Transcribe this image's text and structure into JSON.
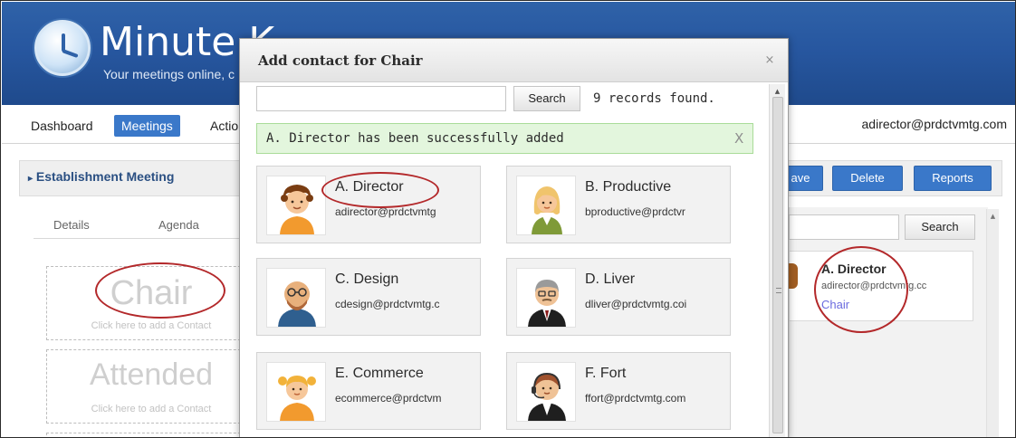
{
  "app": {
    "title": "Minute K",
    "tagline": "Your meetings online, c"
  },
  "nav": {
    "items": [
      {
        "label": "Dashboard",
        "active": false
      },
      {
        "label": "Meetings",
        "active": true
      },
      {
        "label": "Actio",
        "active": false
      }
    ],
    "user_email": "adirector@prdctvmtg.com"
  },
  "meeting": {
    "title": "Establishment Meeting",
    "buttons": [
      "ave",
      "Delete",
      "Reports"
    ],
    "tabs": [
      "Details",
      "Agenda"
    ]
  },
  "slots": [
    {
      "title": "Chair",
      "hint": "Click here to add a Contact"
    },
    {
      "title": "Attended",
      "hint": "Click here to add a Contact"
    }
  ],
  "right_panel": {
    "search_label": "Search",
    "selected": {
      "name": "A. Director",
      "email": "adirector@prdctvmtg.cc",
      "role": "Chair"
    }
  },
  "modal": {
    "title": "Add contact for Chair",
    "close_glyph": "×",
    "search_label": "Search",
    "search_value": "",
    "records_found": "9 records found.",
    "alert": "A. Director has been successfully added",
    "alert_close": "X",
    "contacts": [
      {
        "name": "A. Director",
        "email": "adirector@prdctvmtg",
        "avatar": "male-curly-hair"
      },
      {
        "name": "B. Productive",
        "email": "bproductive@prdctvr",
        "avatar": "female-blonde"
      },
      {
        "name": "C. Design",
        "email": "cdesign@prdctvmtg.c",
        "avatar": "male-bald-glasses"
      },
      {
        "name": "D. Liver",
        "email": "dliver@prdctvmtg.coi",
        "avatar": "male-suit-glasses"
      },
      {
        "name": "E. Commerce",
        "email": "ecommerce@prdctvm",
        "avatar": "female-pigtails"
      },
      {
        "name": "F. Fort",
        "email": "ffort@prdctvmtg.com",
        "avatar": "male-headset"
      }
    ]
  },
  "colors": {
    "banner": "#2757a0",
    "accent_button": "#3a78c9",
    "alert_bg": "#e3f6dd",
    "annotation_red": "#b3282a"
  }
}
